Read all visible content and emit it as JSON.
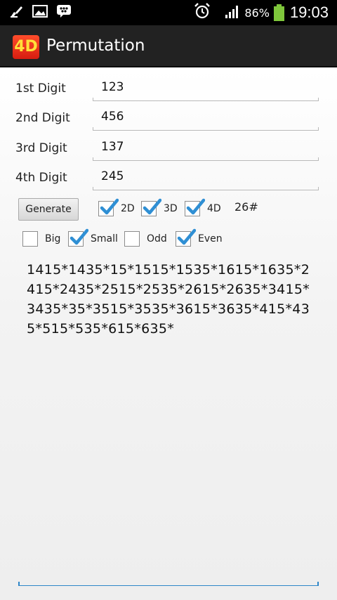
{
  "status_bar": {
    "icons": [
      "cleaner-icon",
      "image-icon",
      "bbm-icon",
      "alarm-icon",
      "signal-icon"
    ],
    "battery_pct": "86%",
    "time": "19:03"
  },
  "app": {
    "logo_text": "4D",
    "title": "Permutation"
  },
  "digits": [
    {
      "label": "1st Digit",
      "value": "123"
    },
    {
      "label": "2nd Digit",
      "value": "456"
    },
    {
      "label": "3rd Digit",
      "value": "137"
    },
    {
      "label": "4th Digit",
      "value": "245"
    }
  ],
  "generate_label": "Generate",
  "options_row1": [
    {
      "label": "2D",
      "checked": true
    },
    {
      "label": "3D",
      "checked": true
    },
    {
      "label": "4D",
      "checked": true
    }
  ],
  "count": "26#",
  "options_row2": [
    {
      "label": "Big",
      "checked": false
    },
    {
      "label": "Small",
      "checked": true
    },
    {
      "label": "Odd",
      "checked": false
    },
    {
      "label": "Even",
      "checked": true
    }
  ],
  "result_text": "1415*1435*15*1515*1535*1615*1635*2415*2435*2515*2535*2615*2635*3415*3435*35*3515*3535*3615*3635*415*435*515*535*615*635*",
  "colors": {
    "accent": "#2e86c8",
    "check": "#2f8fd4",
    "battery": "#7ec63b"
  }
}
